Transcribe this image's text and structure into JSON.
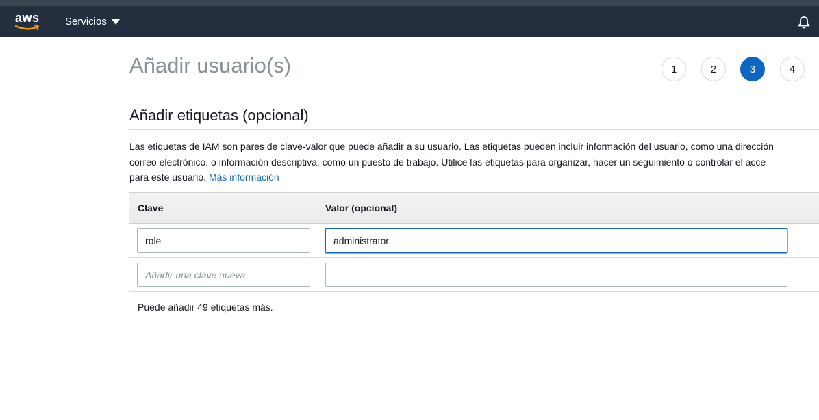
{
  "navbar": {
    "logo_text": "aws",
    "services_label": "Servicios"
  },
  "page": {
    "title": "Añadir usuario(s)"
  },
  "steps": [
    {
      "label": "1",
      "active": false
    },
    {
      "label": "2",
      "active": false
    },
    {
      "label": "3",
      "active": true
    },
    {
      "label": "4",
      "active": false
    }
  ],
  "section": {
    "title": "Añadir etiquetas (opcional)",
    "description_line1": "Las etiquetas de IAM son pares de clave-valor que puede añadir a su usuario. Las etiquetas pueden incluir información del usuario, como una dirección",
    "description_line2": "correo electrónico, o información descriptiva, como un puesto de trabajo. Utilice las etiquetas para organizar, hacer un seguimiento o controlar el acce",
    "description_line3": "para este usuario.",
    "more_info_link": "Más información"
  },
  "table": {
    "headers": {
      "key": "Clave",
      "value": "Valor (opcional)"
    },
    "rows": [
      {
        "key": "role",
        "value": "administrator"
      },
      {
        "key": "",
        "value": "",
        "key_placeholder": "Añadir una clave nueva"
      }
    ]
  },
  "remaining_text": "Puede añadir 49 etiquetas más.",
  "colors": {
    "navbar_bg": "#232f3e",
    "accent": "#0f66c1"
  },
  "icons": {
    "logo": "aws-logo-icon",
    "services_dropdown": "caret-down-icon",
    "notifications": "bell-icon"
  }
}
